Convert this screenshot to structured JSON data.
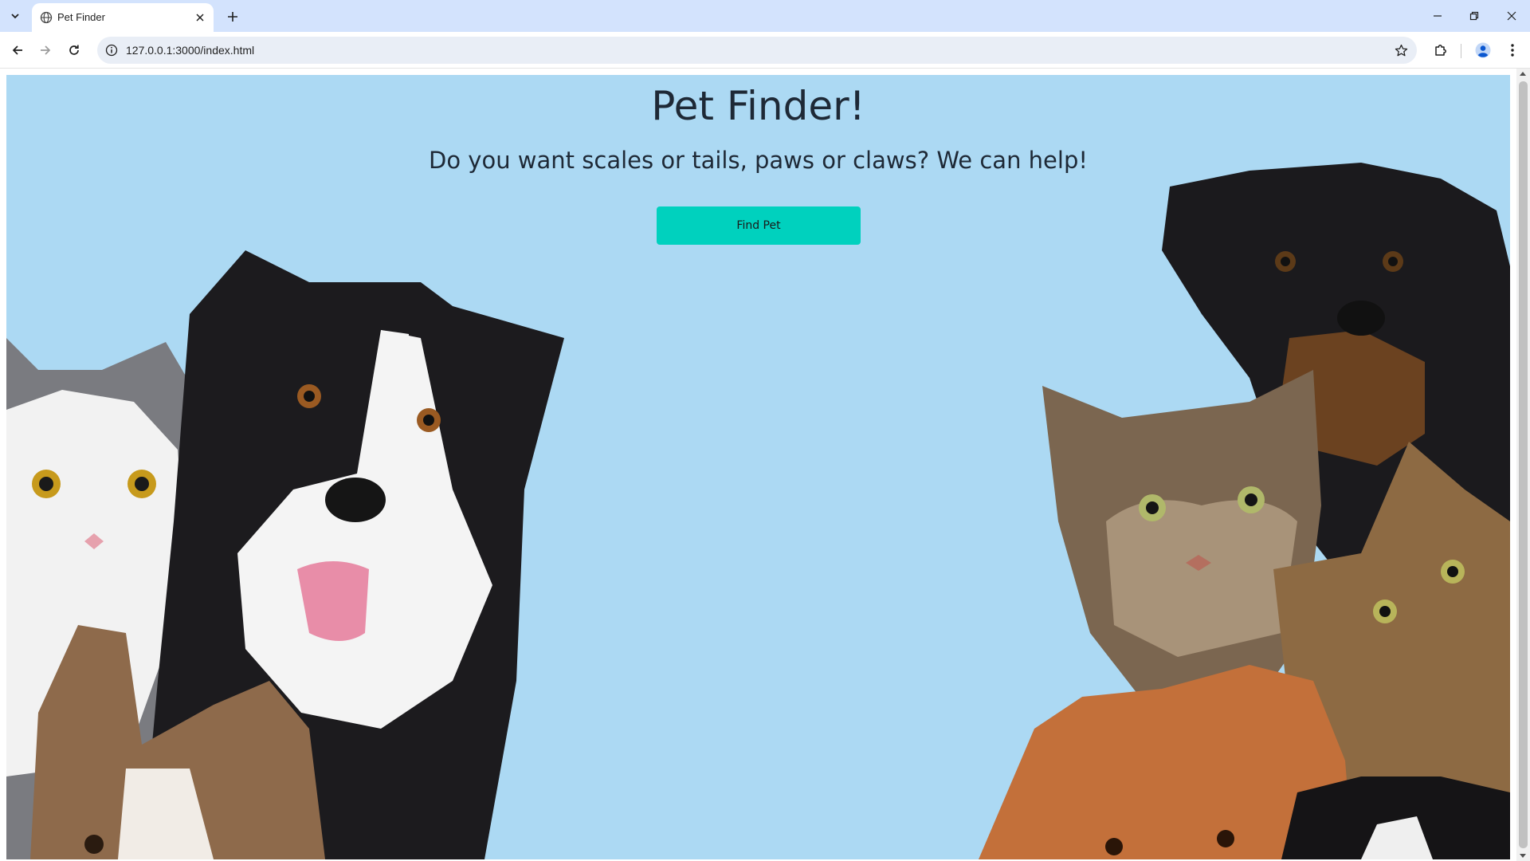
{
  "browser": {
    "tab_title": "Pet Finder",
    "url": "127.0.0.1:3000/index.html"
  },
  "page": {
    "title": "Pet Finder!",
    "subtitle": "Do you want scales or tails, paws or claws? We can help!",
    "button_label": "Find Pet",
    "background_color": "#acd9f3",
    "button_color": "#00d1be",
    "text_color": "#1e2936"
  },
  "icons": {
    "tab_search": "chevron-down-icon",
    "tab_favicon": "globe-icon",
    "tab_close": "close-icon",
    "new_tab": "plus-icon",
    "back": "arrow-left-icon",
    "forward": "arrow-right-icon",
    "reload": "reload-icon",
    "site_info": "info-icon",
    "bookmark": "star-icon",
    "extensions": "puzzle-icon",
    "profile": "profile-icon",
    "menu": "kebab-menu-icon",
    "minimize": "minimize-icon",
    "restore": "restore-icon",
    "close_window": "close-icon"
  }
}
